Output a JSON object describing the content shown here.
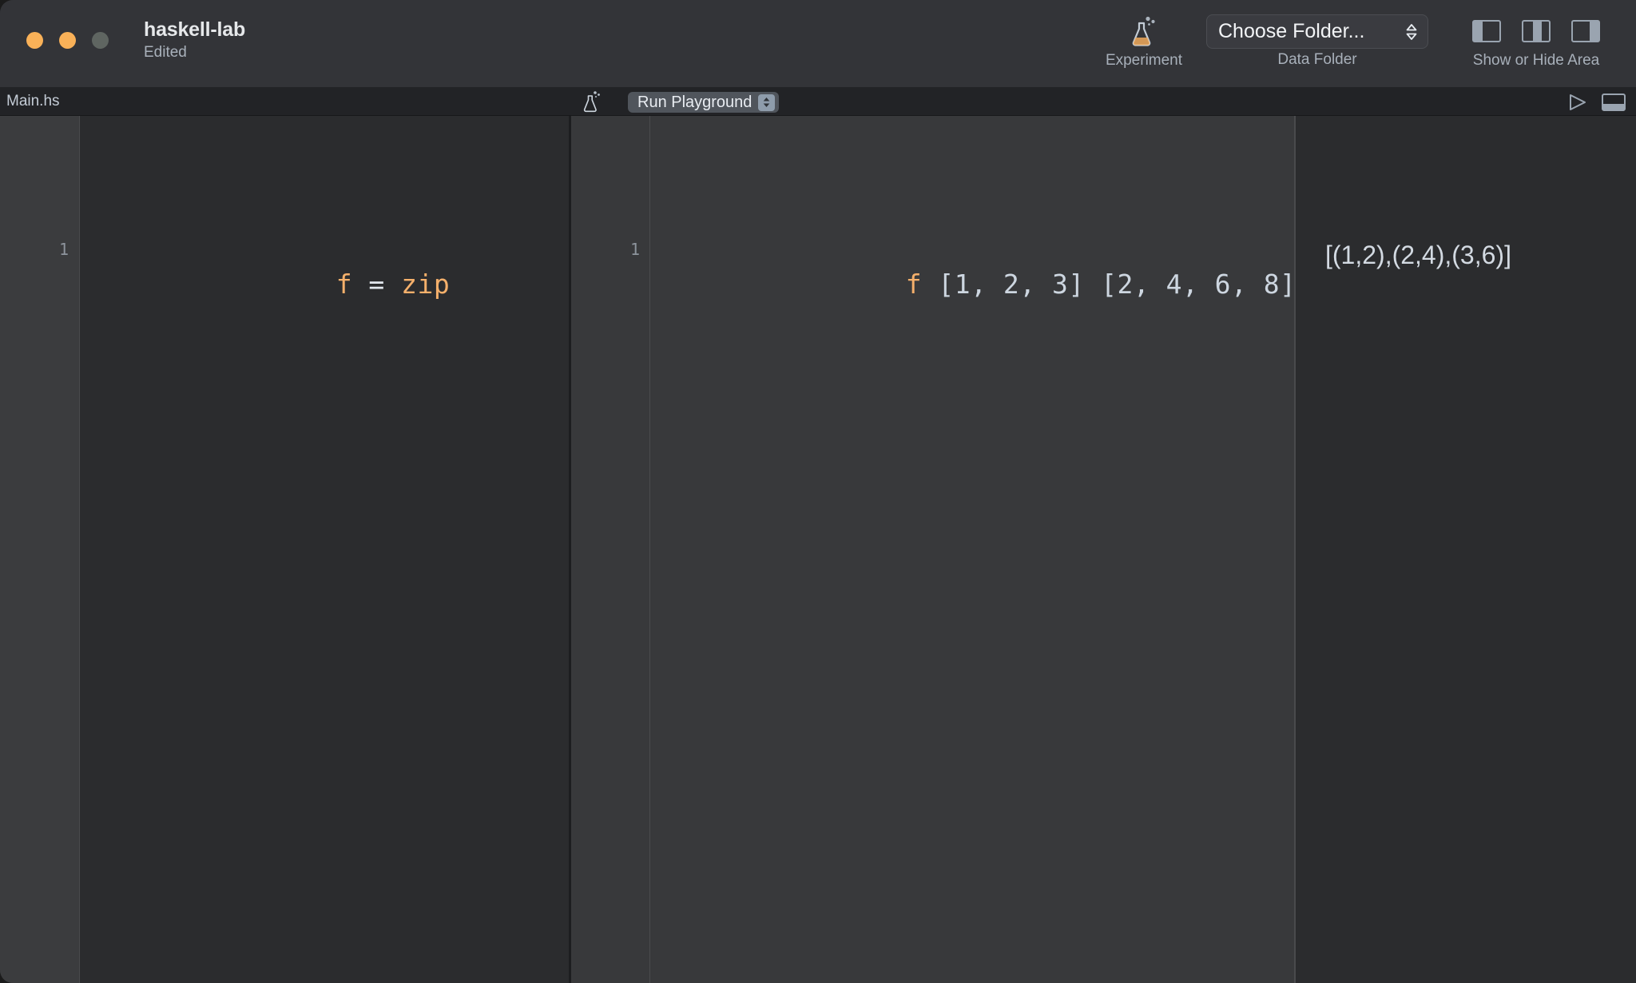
{
  "window": {
    "title": "haskell-lab",
    "subtitle": "Edited",
    "traffic_lights": [
      {
        "name": "close",
        "color": "#f9b158"
      },
      {
        "name": "minimize",
        "color": "#f9b158"
      },
      {
        "name": "zoom",
        "color": "#5f6561"
      }
    ]
  },
  "toolbar": {
    "experiment": {
      "icon": "flask-icon",
      "caption": "Experiment"
    },
    "data_folder": {
      "popup_label": "Choose Folder...",
      "caption": "Data Folder",
      "icon": "chevron-up-down-icon"
    },
    "show_or_hide_area": {
      "caption": "Show or Hide Area",
      "buttons": [
        {
          "name": "left-panel-toggle",
          "icon": "panel-left-icon"
        },
        {
          "name": "center-panel-toggle",
          "icon": "panel-center-icon"
        },
        {
          "name": "right-panel-toggle",
          "icon": "panel-right-icon"
        }
      ]
    }
  },
  "subbar": {
    "filename": "Main.hs",
    "flask_icon": "flask-icon",
    "run_playground_label": "Run Playground",
    "run_chevron_icon": "chevron-up-down-icon",
    "play_icon": "play-triangle-icon",
    "bottom_panel_icon": "panel-bottom-icon"
  },
  "source_editor": {
    "line_numbers": [
      "1"
    ],
    "lines": [
      {
        "tokens": [
          {
            "text": "f",
            "class": "tok-fn"
          },
          {
            "text": " = ",
            "class": "tok-op"
          },
          {
            "text": "zip",
            "class": "tok-id"
          }
        ]
      }
    ],
    "plain_line_1": "f = zip"
  },
  "playground": {
    "line_numbers": [
      "1"
    ],
    "lines": [
      {
        "tokens": [
          {
            "text": "f",
            "class": "tok-fn"
          },
          {
            "text": " [1, 2, 3] [2, 4, 6, 8]",
            "class": "tok-lit"
          }
        ]
      }
    ],
    "plain_line_1": "f [1, 2, 3] [2, 4, 6, 8]"
  },
  "results": {
    "lines": [
      "[(1,2),(2,4),(3,6)]"
    ],
    "line_1": "[(1,2),(2,4),(3,6)]"
  },
  "colors": {
    "titlebar_bg": "#333438",
    "subbar_bg": "#222326",
    "editor_bg": "#2b2c2e",
    "gutter_bg": "#3b3c3e",
    "playground_bg": "#38393b",
    "accent_orange": "#f5b06b",
    "text_light": "#cdd6e0",
    "caption_gray": "#a8b0ba"
  }
}
